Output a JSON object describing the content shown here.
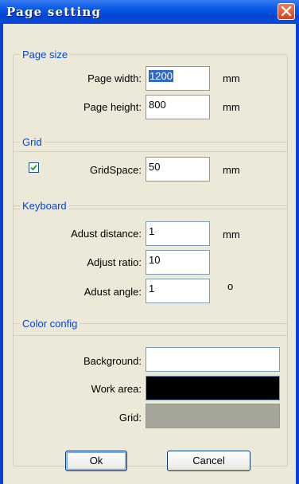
{
  "window": {
    "title": "Page setting"
  },
  "page_size": {
    "label": "Page size",
    "width_label": "Page width:",
    "width_value": "1200",
    "width_unit": "mm",
    "height_label": "Page height:",
    "height_value": "800",
    "height_unit": "mm"
  },
  "grid": {
    "label": "Grid",
    "checked": true,
    "space_label": "GridSpace:",
    "space_value": "50",
    "space_unit": "mm"
  },
  "keyboard": {
    "label": "Keyboard",
    "distance_label": "Adust distance:",
    "distance_value": "1",
    "distance_unit": "mm",
    "ratio_label": "Adjust ratio:",
    "ratio_value": "10",
    "angle_label": "Adust angle:",
    "angle_value": "1",
    "angle_unit": "o"
  },
  "color_config": {
    "label": "Color config",
    "background_label": "Background:",
    "background_color": "#ffffff",
    "work_area_label": "Work area:",
    "work_area_color": "#000000",
    "grid_label": "Grid:",
    "grid_color": "#a6a59a"
  },
  "buttons": {
    "ok": "Ok",
    "cancel": "Cancel"
  },
  "colors": {
    "titlebar": "#0a50d8",
    "close": "#d8401a",
    "group_label": "#0046d5",
    "face": "#ece9d8"
  }
}
